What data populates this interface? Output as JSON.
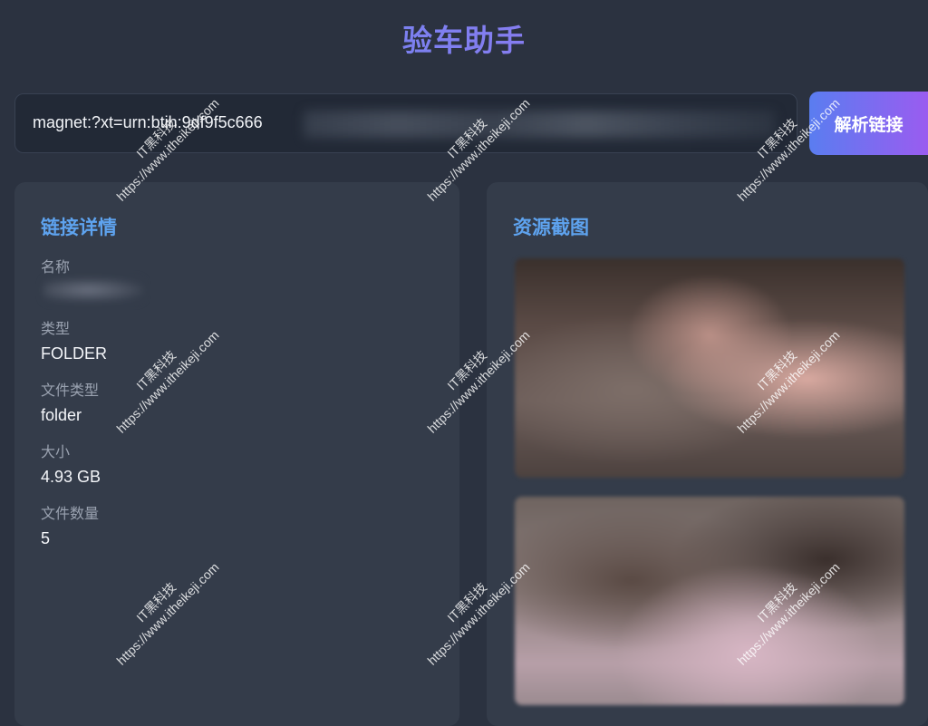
{
  "header": {
    "title": "验车助手"
  },
  "search": {
    "value": "magnet:?xt=urn:btih:9df9f5c666",
    "button_label": "解析链接"
  },
  "details": {
    "heading": "链接详情",
    "fields": [
      {
        "label": "名称",
        "value": ""
      },
      {
        "label": "类型",
        "value": "FOLDER"
      },
      {
        "label": "文件类型",
        "value": "folder"
      },
      {
        "label": "大小",
        "value": "4.93 GB"
      },
      {
        "label": "文件数量",
        "value": "5"
      }
    ]
  },
  "screenshots": {
    "heading": "资源截图"
  },
  "watermark": {
    "line1": "IT黑科技",
    "line2": "https://www.itheikeji.com"
  },
  "colors": {
    "accent_blue": "#5ea3ef",
    "button_gradient_start": "#5a7df0",
    "button_gradient_end": "#9a5cf0",
    "background": "#2b3240",
    "panel": "#343c4a"
  }
}
